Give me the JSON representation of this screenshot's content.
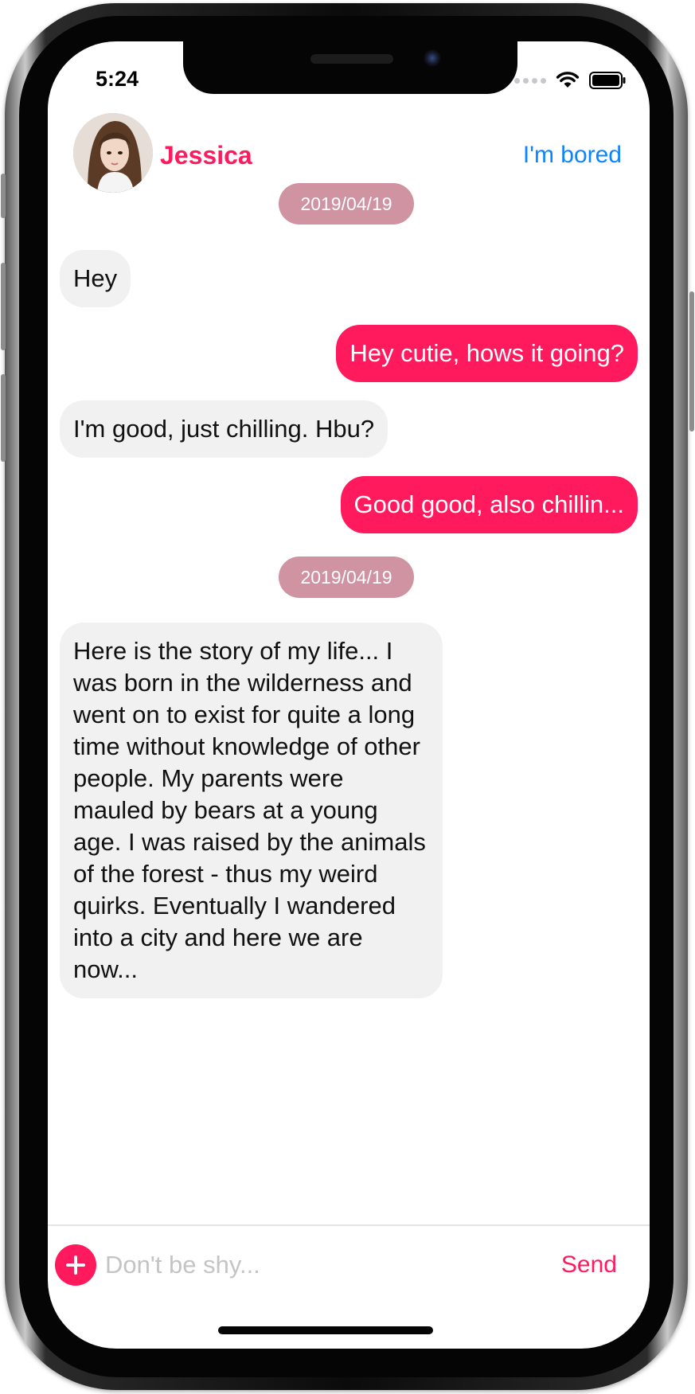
{
  "status_bar": {
    "time": "5:24",
    "signal_icon": "signal-dots-icon",
    "wifi_icon": "wifi-icon",
    "battery_icon": "battery-icon"
  },
  "header": {
    "contact_name": "Jessica",
    "action_label": "I'm bored",
    "avatar_icon": "contact-avatar"
  },
  "messages": {
    "date_1": "2019/04/19",
    "date_2": "2019/04/19",
    "m1": {
      "sender": "contact",
      "text": "Hey"
    },
    "m2": {
      "sender": "me",
      "text": "Hey cutie, hows it going?"
    },
    "m3": {
      "sender": "contact",
      "text": "I'm good, just chilling. Hbu?"
    },
    "m4": {
      "sender": "me",
      "text": "Good good, also chillin..."
    },
    "m5": {
      "sender": "contact",
      "text": "Here is the story of my life... I was born in the wilderness and went on to exist for quite a long time without knowledge of other people. My parents were mauled by bears at a young age. I was raised by the animals of the forest - thus my weird quirks. Eventually I wandered into a city and here we are now..."
    }
  },
  "composer": {
    "placeholder": "Don't be shy...",
    "value": "",
    "send_label": "Send",
    "add_icon": "plus-icon"
  },
  "colors": {
    "accent": "#ff1a5e",
    "link": "#0a84ff",
    "date_pill": "#cf93a2",
    "incoming_bubble": "#f1f1f1"
  }
}
